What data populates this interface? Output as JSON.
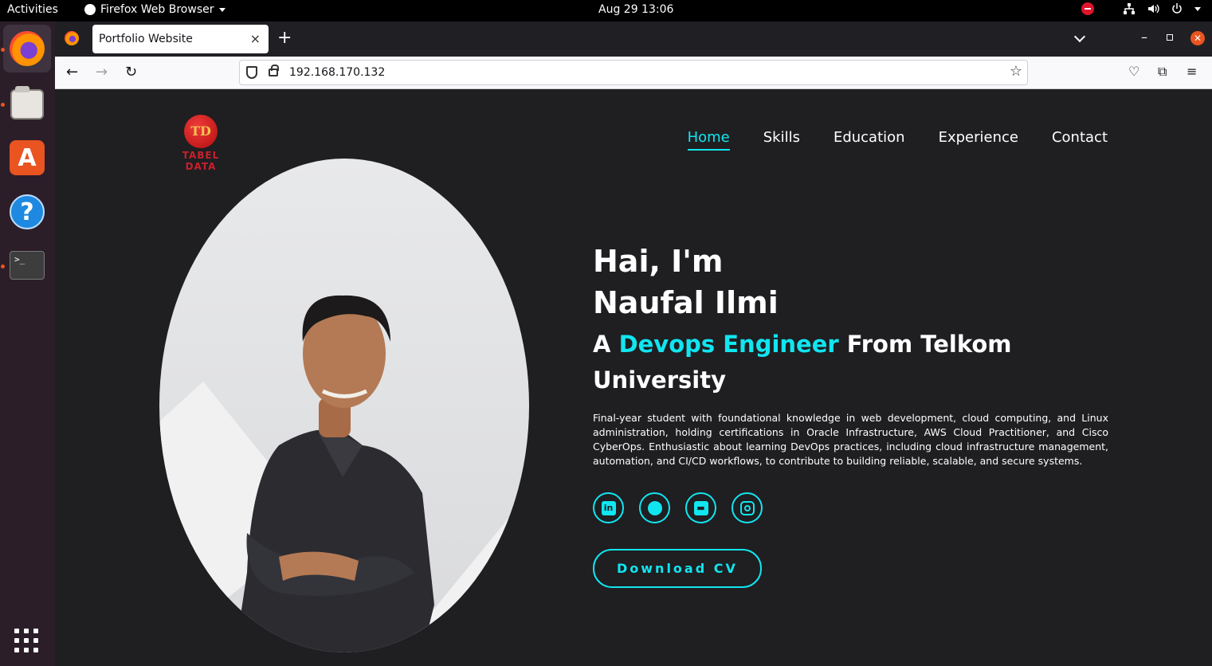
{
  "topbar": {
    "activities": "Activities",
    "app_name": "Firefox Web Browser",
    "clock": "Aug 29  13:06"
  },
  "browser": {
    "tab_title": "Portfolio Website",
    "tab_close": "×",
    "new_tab": "+",
    "url": "192.168.170.132",
    "accent_color": "#e95420"
  },
  "site": {
    "logo_mark": "TD",
    "logo_text": "TABEL DATA",
    "nav": [
      "Home",
      "Skills",
      "Education",
      "Experience",
      "Contact"
    ],
    "active_nav": "Home",
    "greeting": "Hai, I'm",
    "name": "Naufal Ilmi",
    "role_prefix": "A",
    "role": "Devops Engineer",
    "role_suffix": "From Telkom University",
    "bio": "Final-year student with foundational knowledge in web development, cloud computing, and Linux administration, holding certifications in Oracle Infrastructure, AWS Cloud Practitioner, and Cisco CyberOps. Enthusiastic about learning DevOps practices, including cloud infrastructure management, automation, and CI/CD workflows, to contribute to building reliable, scalable, and secure systems.",
    "socials": [
      "linkedin-icon",
      "github-icon",
      "blogger-icon",
      "instagram-icon"
    ],
    "cv_button": "Download CV",
    "accent_color": "#10e6f0",
    "background_color": "#1f1e21"
  }
}
